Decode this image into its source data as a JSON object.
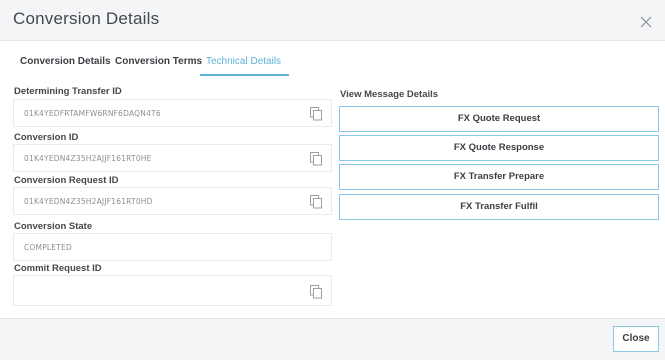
{
  "modal": {
    "title": "Conversion Details",
    "close_icon": "close-icon"
  },
  "tabs": [
    {
      "label": "Conversion Details",
      "active": false
    },
    {
      "label": "Conversion Terms",
      "active": false
    },
    {
      "label": "Technical Details",
      "active": true
    }
  ],
  "fields": [
    {
      "label": "Determining Transfer ID",
      "value": "01K4YEDFRTAMFW6RNF6DAQN4T6",
      "copy_icon": "copy-icon"
    },
    {
      "label": "Conversion ID",
      "value": "01K4YEDN4Z35H2AJJF161RT0HE",
      "copy_icon": "copy-icon"
    },
    {
      "label": "Conversion Request ID",
      "value": "01K4YEDN4Z35H2AJJF161RT0HD",
      "copy_icon": "copy-icon"
    },
    {
      "label": "Conversion State",
      "value": "COMPLETED"
    },
    {
      "label": "Commit Request ID",
      "value": "",
      "copy_icon": "copy-icon"
    }
  ],
  "message_details": {
    "label": "View Message Details",
    "buttons": [
      {
        "label": "FX Quote Request"
      },
      {
        "label": "FX Quote Response"
      },
      {
        "label": "FX Transfer Prepare"
      },
      {
        "label": "FX Transfer Fulfil"
      }
    ]
  },
  "footer": {
    "close_label": "Close"
  },
  "colors": {
    "accent": "#5eb3d6",
    "button_border": "#8bc8e6",
    "header_bg": "#f4f5f6"
  }
}
